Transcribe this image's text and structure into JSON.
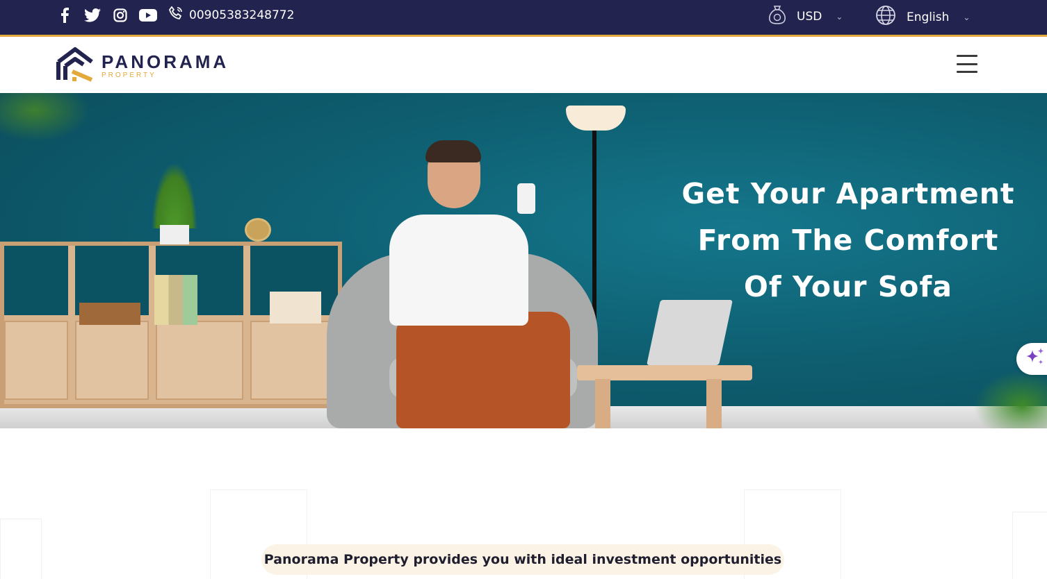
{
  "topbar": {
    "social_icons": [
      "facebook-icon",
      "twitter-icon",
      "instagram-icon",
      "youtube-icon"
    ],
    "phone_icon": "phone-icon",
    "phone": "00905383248772",
    "currency": {
      "icon": "money-bag-icon",
      "label": "USD"
    },
    "language": {
      "icon": "globe-icon",
      "label": "English"
    }
  },
  "header": {
    "logo_main": "PANORAMA",
    "logo_sub": "PROPERTY",
    "menu_icon": "hamburger-menu-icon"
  },
  "hero": {
    "title_lines": [
      "Get Your Apartment",
      "From The Comfort",
      "Of Your Sofa"
    ],
    "ai_button_icon": "sparkle-icon"
  },
  "intro": {
    "tagline": "Panorama Property provides you with ideal investment opportunities"
  },
  "colors": {
    "topbar_bg": "#23234f",
    "accent": "#e3a93a",
    "hero_bg": "#0e5f71"
  }
}
